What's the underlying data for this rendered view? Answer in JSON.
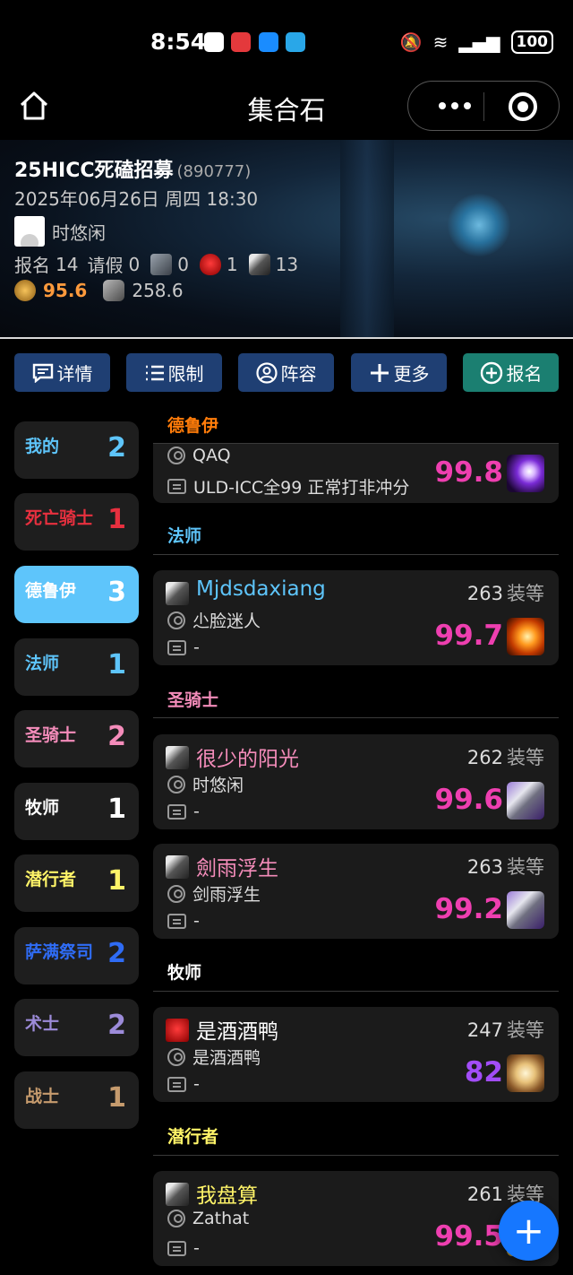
{
  "status_bar": {
    "time": "8:54",
    "battery": "100"
  },
  "nav": {
    "title": "集合石"
  },
  "header": {
    "title": "25HICC死磕招募",
    "id": "(890777)",
    "datetime": "2025年06月26日 周四 18:30",
    "leader": "时悠闲",
    "signup_label": "报名",
    "signup_count": "14",
    "leave_label": "请假",
    "leave_count": "0",
    "tank_count": "0",
    "healer_count": "1",
    "dps_count": "13",
    "gearscore_avg": "95.6",
    "itemlevel_avg": "258.6"
  },
  "actions": [
    {
      "label": "详情",
      "icon": "comment-icon"
    },
    {
      "label": "限制",
      "icon": "list-icon"
    },
    {
      "label": "阵容",
      "icon": "user-icon"
    },
    {
      "label": "更多",
      "icon": "plus-icon"
    },
    {
      "label": "报名",
      "icon": "plus-circle-icon"
    }
  ],
  "sidebar": [
    {
      "label": "我的",
      "count": "2",
      "color": "#5ec5fb"
    },
    {
      "label": "死亡骑士",
      "count": "1",
      "color": "#e8303f"
    },
    {
      "label": "德鲁伊",
      "count": "3",
      "color": "#ffffff"
    },
    {
      "label": "法师",
      "count": "1",
      "color": "#5ec5fb"
    },
    {
      "label": "圣骑士",
      "count": "2",
      "color": "#f48cba"
    },
    {
      "label": "牧师",
      "count": "1",
      "color": "#ffffff"
    },
    {
      "label": "潜行者",
      "count": "1",
      "color": "#fff468"
    },
    {
      "label": "萨满祭司",
      "count": "2",
      "color": "#2f6cf5"
    },
    {
      "label": "术士",
      "count": "2",
      "color": "#9c8bd9"
    },
    {
      "label": "战士",
      "count": "1",
      "color": "#c69b6d"
    }
  ],
  "sections": {
    "druid": {
      "title": "德鲁伊",
      "color": "#ff7c0a"
    },
    "mage": {
      "title": "法师",
      "color": "#5ec5fb"
    },
    "paladin": {
      "title": "圣骑士",
      "color": "#f48cba"
    },
    "priest": {
      "title": "牧师",
      "color": "#ffffff"
    },
    "rogue": {
      "title": "潜行者",
      "color": "#fff468"
    }
  },
  "cards": {
    "druid1": {
      "player": "QAQ",
      "comment": "ULD-ICC全99 正常打非冲分",
      "score": "99.8",
      "spec_icon": "arcane-burst-icon"
    },
    "mage1": {
      "name": "Mjdsdaxiang",
      "ilvl": "263",
      "unit": "装等",
      "player": "尐脸迷人",
      "comment": "-",
      "score": "99.7",
      "spec_icon": "fire-icon"
    },
    "pal1": {
      "name": "很少的阳光",
      "ilvl": "262",
      "unit": "装等",
      "player": "时悠闲",
      "comment": "-",
      "score": "99.6",
      "spec_icon": "hammer-icon"
    },
    "pal2": {
      "name": "劍雨浮生",
      "ilvl": "263",
      "unit": "装等",
      "player": "剑雨浮生",
      "comment": "-",
      "score": "99.2",
      "spec_icon": "hammer-icon"
    },
    "priest1": {
      "name": "是酒酒鸭",
      "ilvl": "247",
      "unit": "装等",
      "player": "是酒酒鸭",
      "comment": "-",
      "score": "82",
      "spec_icon": "shield-icon"
    },
    "rogue1": {
      "name": "我盘算",
      "ilvl": "261",
      "unit": "装等",
      "player": "Zathat",
      "comment": "-",
      "score": "99.5",
      "spec_icon": "dagger-icon"
    }
  }
}
